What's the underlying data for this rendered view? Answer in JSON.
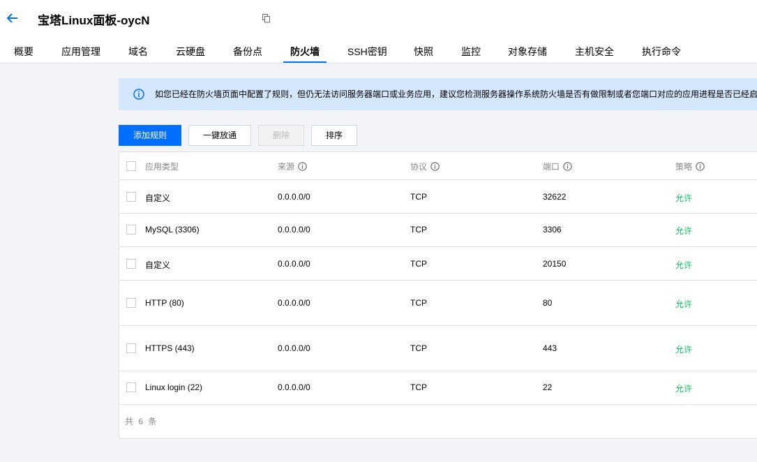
{
  "header": {
    "title": "宝塔Linux面板-oycN",
    "back_icon": "arrow-left-icon",
    "copy_icon": "copy-icon"
  },
  "tabs": [
    {
      "label": "概要"
    },
    {
      "label": "应用管理"
    },
    {
      "label": "域名"
    },
    {
      "label": "云硬盘"
    },
    {
      "label": "备份点"
    },
    {
      "label": "防火墙",
      "active": true
    },
    {
      "label": "SSH密钥"
    },
    {
      "label": "快照"
    },
    {
      "label": "监控"
    },
    {
      "label": "对象存储"
    },
    {
      "label": "主机安全"
    },
    {
      "label": "执行命令"
    }
  ],
  "notice": {
    "icon": "info-icon",
    "text": "如您已经在防火墙页面中配置了规则，但仍无法访问服务器端口或业务应用，建议您检测服务器操作系统防火墙是否有做限制或者您端口对应的应用进程是否已经启"
  },
  "toolbar": {
    "add_rule": "添加规则",
    "one_click_open": "一键放通",
    "delete": "删除",
    "sort": "排序"
  },
  "table": {
    "columns": {
      "app_type": "应用类型",
      "source": "来源",
      "protocol": "协议",
      "port": "端口",
      "policy": "策略"
    },
    "rows": [
      {
        "app_type": "自定义",
        "source": "0.0.0.0/0",
        "protocol": "TCP",
        "port": "32622",
        "policy": "允许"
      },
      {
        "app_type": "MySQL (3306)",
        "source": "0.0.0.0/0",
        "protocol": "TCP",
        "port": "3306",
        "policy": "允许"
      },
      {
        "app_type": "自定义",
        "source": "0.0.0.0/0",
        "protocol": "TCP",
        "port": "20150",
        "policy": "允许"
      },
      {
        "app_type": "HTTP (80)",
        "source": "0.0.0.0/0",
        "protocol": "TCP",
        "port": "80",
        "policy": "允许"
      },
      {
        "app_type": "HTTPS (443)",
        "source": "0.0.0.0/0",
        "protocol": "TCP",
        "port": "443",
        "policy": "允许"
      },
      {
        "app_type": "Linux login (22)",
        "source": "0.0.0.0/0",
        "protocol": "TCP",
        "port": "22",
        "policy": "允许"
      }
    ],
    "footer": "共 6 条"
  },
  "colors": {
    "accent": "#006eff",
    "allow": "#0abf5b",
    "notice_bg": "#d5e7fd"
  }
}
